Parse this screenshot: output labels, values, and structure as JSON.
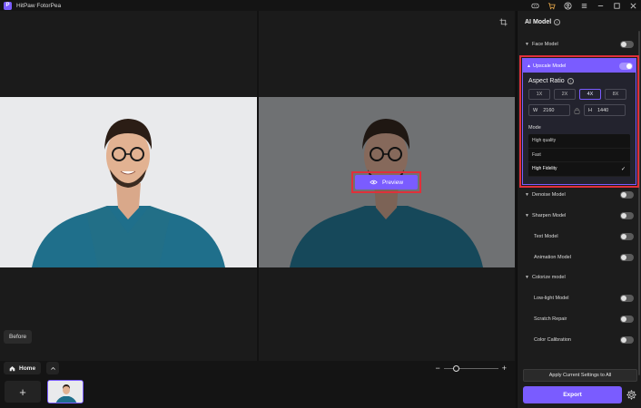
{
  "app": {
    "title": "HitPaw FotorPea",
    "logo_letter": "P"
  },
  "canvas": {
    "before_label": "Before",
    "preview_label": "Preview"
  },
  "bottom": {
    "home_label": "Home",
    "add_symbol": "+",
    "zoom_minus": "−",
    "zoom_plus": "+"
  },
  "panel": {
    "title": "AI Model",
    "face_model": "Face Model",
    "upscale": {
      "label": "Upscale Model",
      "aspect_title": "Aspect Ratio",
      "ratios": [
        "1X",
        "2X",
        "4X",
        "8X"
      ],
      "selected_ratio": "4X",
      "width_prefix": "W",
      "width_value": "2160",
      "height_prefix": "H",
      "height_value": "1440",
      "mode_label": "Mode",
      "modes": [
        "High quality",
        "Fast",
        "High Fidelity"
      ],
      "selected_mode": "High Fidelity"
    },
    "denoise_model": "Denoise Model",
    "sharpen_model": "Sharpen Model",
    "text_model": "Text Model",
    "animation_model": "Animation Model",
    "colorize_model": "Colorize model",
    "lowlight_model": "Low-light Model",
    "scratch_repair": "Scratch Repair",
    "color_calibration": "Color Calibration",
    "apply_label": "Apply Current Settings to All",
    "export_label": "Export"
  },
  "colors": {
    "accent": "#7a5cff",
    "highlight": "#e0303a",
    "background": "#121212"
  }
}
